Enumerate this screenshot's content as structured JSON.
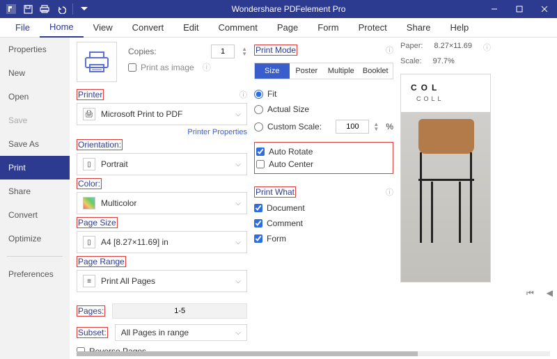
{
  "titlebar": {
    "title": "Wondershare PDFelement Pro"
  },
  "tabs": {
    "file": "File",
    "home": "Home",
    "view": "View",
    "convert": "Convert",
    "edit": "Edit",
    "comment": "Comment",
    "page": "Page",
    "form": "Form",
    "protect": "Protect",
    "share": "Share",
    "help": "Help"
  },
  "sidebar": {
    "properties": "Properties",
    "new": "New",
    "open": "Open",
    "save": "Save",
    "saveas": "Save As",
    "print": "Print",
    "share": "Share",
    "convert": "Convert",
    "optimize": "Optimize",
    "preferences": "Preferences"
  },
  "printPanel": {
    "copiesLabel": "Copies:",
    "copiesValue": "1",
    "printAsImage": "Print as image",
    "printerLabel": "Printer",
    "printerValue": "Microsoft Print to PDF",
    "printerProps": "Printer Properties",
    "orientationLabel": "Orientation:",
    "orientationValue": "Portrait",
    "colorLabel": "Color:",
    "colorValue": "Multicolor",
    "pageSizeLabel": "Page Size",
    "pageSizeValue": "A4 [8.27×11.69] in",
    "pageRangeLabel": "Page Range",
    "pageRangeValue": "Print All Pages",
    "pagesLabel": "Pages:",
    "pagesValue": "1-5",
    "subsetLabel": "Subset:",
    "subsetValue": "All Pages in range",
    "reversePages": "Reverse Pages"
  },
  "printMode": {
    "label": "Print Mode",
    "size": "Size",
    "poster": "Poster",
    "multiple": "Multiple",
    "booklet": "Booklet",
    "fit": "Fit",
    "actual": "Actual Size",
    "custom": "Custom Scale:",
    "customValue": "100",
    "percent": "%",
    "autoRotate": "Auto Rotate",
    "autoCenter": "Auto Center"
  },
  "printWhat": {
    "label": "Print What",
    "document": "Document",
    "comment": "Comment",
    "form": "Form"
  },
  "preview": {
    "paperLabel": "Paper:",
    "paperValue": "8.27×11.69",
    "scaleLabel": "Scale:",
    "scaleValue": "97.7%",
    "title": "COL",
    "subtitle": "COLL"
  }
}
